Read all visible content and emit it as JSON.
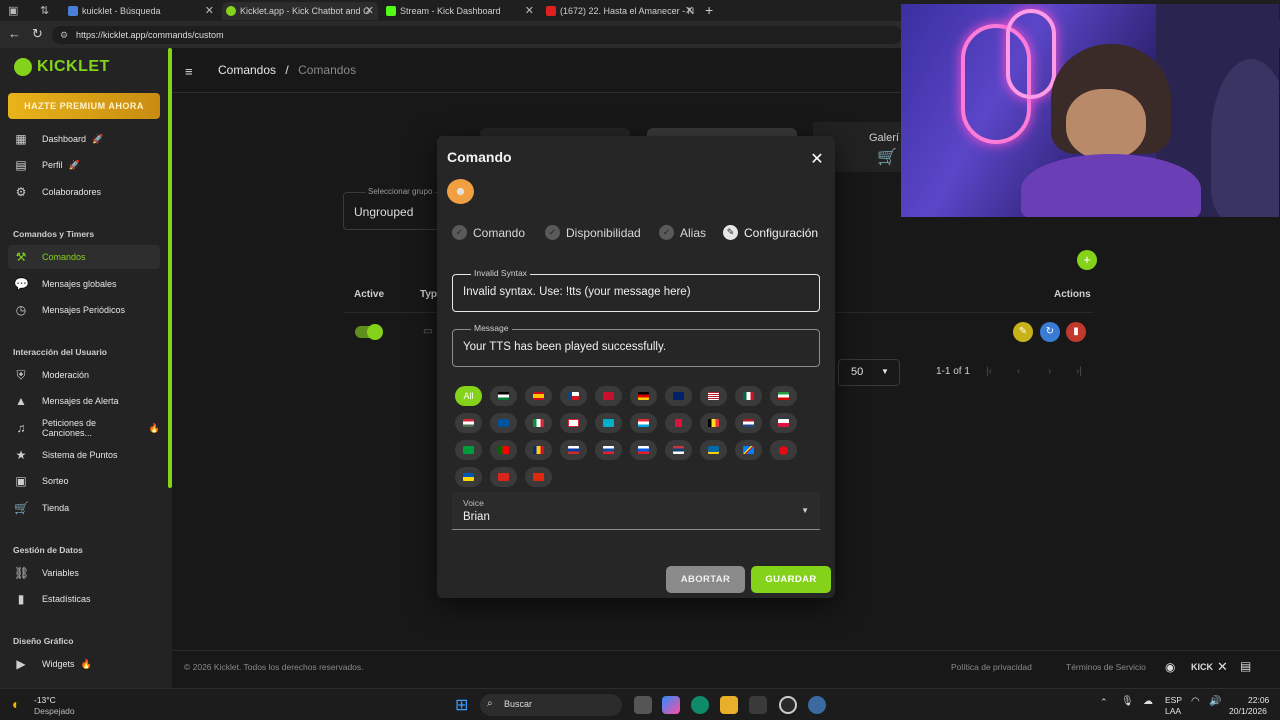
{
  "browser": {
    "tabs": [
      {
        "label": "kuicklet - Búsqueda",
        "active": false
      },
      {
        "label": "Kicklet.app - Kick Chatbot and O",
        "active": true
      },
      {
        "label": "Stream - Kick Dashboard",
        "active": false
      },
      {
        "label": "(1672) 22. Hasta el Amanecer - N",
        "active": false
      }
    ],
    "url": "https://kicklet.app/commands/custom"
  },
  "sidebar": {
    "logo": "KICKLET",
    "premium": "HAZTE PREMIUM AHORA",
    "items": [
      {
        "label": "Dashboard",
        "icon": "dashboard-icon"
      },
      {
        "label": "Perfil",
        "icon": "profile-icon"
      },
      {
        "label": "Colaboradores",
        "icon": "collaborators-icon"
      }
    ],
    "sections": [
      {
        "title": "Comandos y Timers"
      },
      {
        "title": "Interacción del Usuario"
      },
      {
        "title": "Gestión de Datos"
      },
      {
        "title": "Diseño Gráfico"
      }
    ],
    "commands": [
      {
        "label": "Comandos"
      },
      {
        "label": "Mensajes globales"
      },
      {
        "label": "Mensajes Periódicos"
      }
    ],
    "interaction": [
      {
        "label": "Moderación"
      },
      {
        "label": "Mensajes de Alerta"
      },
      {
        "label": "Peticiones de Canciones..."
      },
      {
        "label": "Sistema de Puntos"
      },
      {
        "label": "Sorteo"
      },
      {
        "label": "Tienda"
      }
    ],
    "data_mgmt": [
      {
        "label": "Variables"
      },
      {
        "label": "Estadísticas"
      }
    ],
    "design": [
      {
        "label": "Widgets"
      }
    ]
  },
  "page": {
    "breadcrumb_root": "Comandos",
    "breadcrumb_sep": "/",
    "breadcrumb_current": "Comandos",
    "group_label": "Seleccionar grupo",
    "group_value": "Ungrouped",
    "gallery_label": "Galerí",
    "col_active": "Active",
    "col_type": "Typ",
    "col_actions": "Actions",
    "per_page": "50",
    "range": "1-1 of 1",
    "copyright": "© 2026 Kicklet. Todos los derechos reservados.",
    "privacy": "Política de privacidad",
    "terms": "Términos de Servicio",
    "kick": "KICK"
  },
  "modal": {
    "title": "Comando",
    "steps": [
      {
        "label": "Comando"
      },
      {
        "label": "Disponibilidad"
      },
      {
        "label": "Alias"
      },
      {
        "label": "Configuración"
      }
    ],
    "invalid_label": "Invalid Syntax",
    "invalid_value": "Invalid syntax. Use: !tts (your message here)",
    "message_label": "Message",
    "message_value": "Your TTS has been played successfully.",
    "all_label": "All",
    "voice_label": "Voice",
    "voice_value": "Brian",
    "cancel": "ABORTAR",
    "save": "GUARDAR"
  },
  "taskbar": {
    "temp": "-13°C",
    "weather": "Despejado",
    "search": "Buscar",
    "lang1": "ESP",
    "lang2": "LAA",
    "time": "22:06",
    "date": "20/1/2026"
  },
  "colors": {
    "accent": "#84d21a",
    "premium": "#e9b31a",
    "edit": "#c8b21a",
    "refresh": "#3a7bd5",
    "delete": "#c0392b"
  }
}
